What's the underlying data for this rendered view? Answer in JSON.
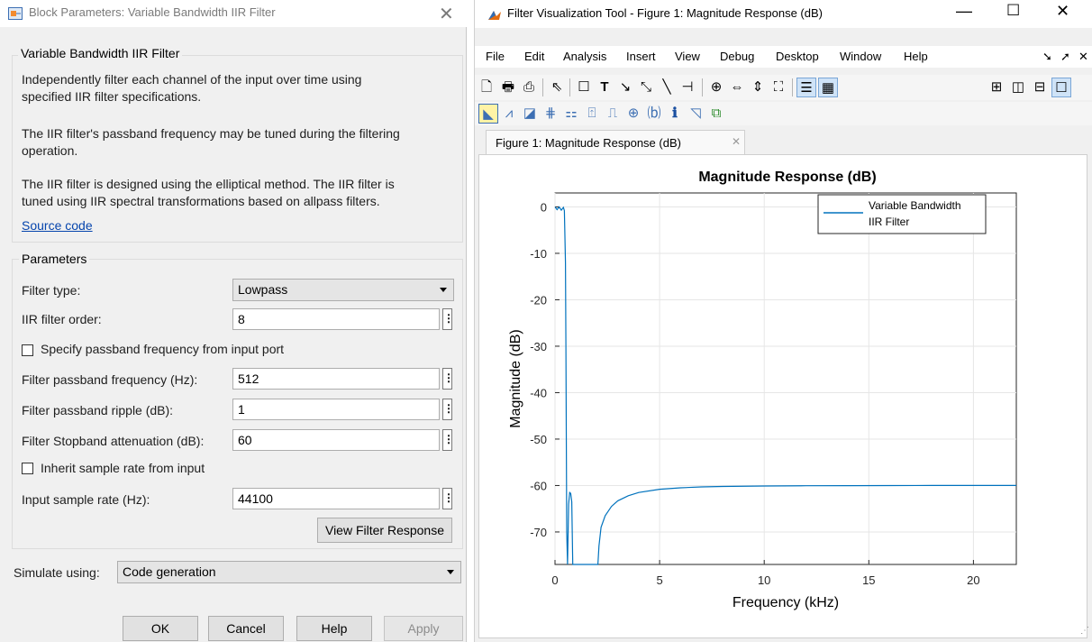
{
  "dialog": {
    "title": "Block Parameters: Variable Bandwidth IIR Filter",
    "block_group_title": "Variable Bandwidth IIR Filter",
    "desc1_line1": "Independently filter each channel of the input over time using",
    "desc1_line2": "specified IIR filter specifications.",
    "desc2_line1": "The IIR filter's passband frequency may be tuned during the filtering",
    "desc2_line2": "operation.",
    "desc3_line1": "The IIR filter is designed using the elliptical method. The IIR filter is",
    "desc3_line2": "tuned using IIR spectral transformations based on allpass filters.",
    "source_link": "Source code",
    "params_title": "Parameters",
    "filter_type_label": "Filter type:",
    "filter_type_value": "Lowpass",
    "order_label": "IIR filter order:",
    "order_value": "8",
    "passband_port_label": "Specify passband frequency from input port",
    "passband_port_checked": false,
    "passband_freq_label": "Filter passband frequency (Hz):",
    "passband_freq_value": "512",
    "ripple_label": "Filter passband ripple (dB):",
    "ripple_value": "1",
    "stopband_label": "Filter Stopband attenuation (dB):",
    "stopband_value": "60",
    "inherit_rate_label": "Inherit sample rate from input",
    "inherit_rate_checked": false,
    "sample_rate_label": "Input sample rate (Hz):",
    "sample_rate_value": "44100",
    "view_response_button": "View Filter Response",
    "simulate_label": "Simulate using:",
    "simulate_value": "Code generation",
    "ok_button": "OK",
    "cancel_button": "Cancel",
    "help_button": "Help",
    "apply_button": "Apply"
  },
  "fvtool": {
    "title": "Filter Visualization Tool - Figure 1: Magnitude Response (dB)",
    "menu": [
      "File",
      "Edit",
      "Analysis",
      "Insert",
      "View",
      "Debug",
      "Desktop",
      "Window",
      "Help"
    ],
    "tab_label": "Figure 1: Magnitude Response (dB)",
    "accent_color": "#0072bd"
  },
  "chart_data": {
    "type": "line",
    "title": "Magnitude Response (dB)",
    "xlabel": "Frequency (kHz)",
    "ylabel": "Magnitude (dB)",
    "xlim": [
      0,
      22.05
    ],
    "ylim": [
      -77,
      3
    ],
    "xticks": [
      0,
      5,
      10,
      15,
      20
    ],
    "yticks": [
      0,
      -10,
      -20,
      -30,
      -40,
      -50,
      -60,
      -70
    ],
    "grid": true,
    "legend_position": "top-right",
    "series": [
      {
        "name": "Variable Bandwidth IIR Filter",
        "color": "#0072bd",
        "x": [
          0,
          0.1,
          0.2,
          0.3,
          0.4,
          0.45,
          0.5,
          0.52,
          0.54,
          0.56,
          0.6,
          0.65,
          0.7,
          0.75,
          0.8,
          0.85,
          0.9,
          1.0,
          1.1,
          1.2,
          1.35,
          1.5,
          1.65,
          1.8,
          1.9,
          1.95,
          2.0,
          2.05,
          2.1,
          2.2,
          2.4,
          2.7,
          3.0,
          3.5,
          4.0,
          5.0,
          6.0,
          7.0,
          8.0,
          10.0,
          12.0,
          14.0,
          16.0,
          18.0,
          20.0,
          22.05
        ],
        "y": [
          0,
          -0.6,
          0,
          -0.7,
          -0.1,
          -0.8,
          -12,
          -30,
          -48,
          -70,
          -77,
          -64,
          -61.5,
          -61.7,
          -63.5,
          -77,
          -77,
          -77,
          -77,
          -77,
          -77,
          -77,
          -77,
          -77,
          -77,
          -77,
          -77,
          -77,
          -73,
          -69,
          -66.5,
          -64.5,
          -63.3,
          -62.2,
          -61.5,
          -60.8,
          -60.5,
          -60.3,
          -60.2,
          -60.1,
          -60.05,
          -60.02,
          -60.01,
          -60.0,
          -60.0,
          -60.0
        ]
      }
    ]
  }
}
